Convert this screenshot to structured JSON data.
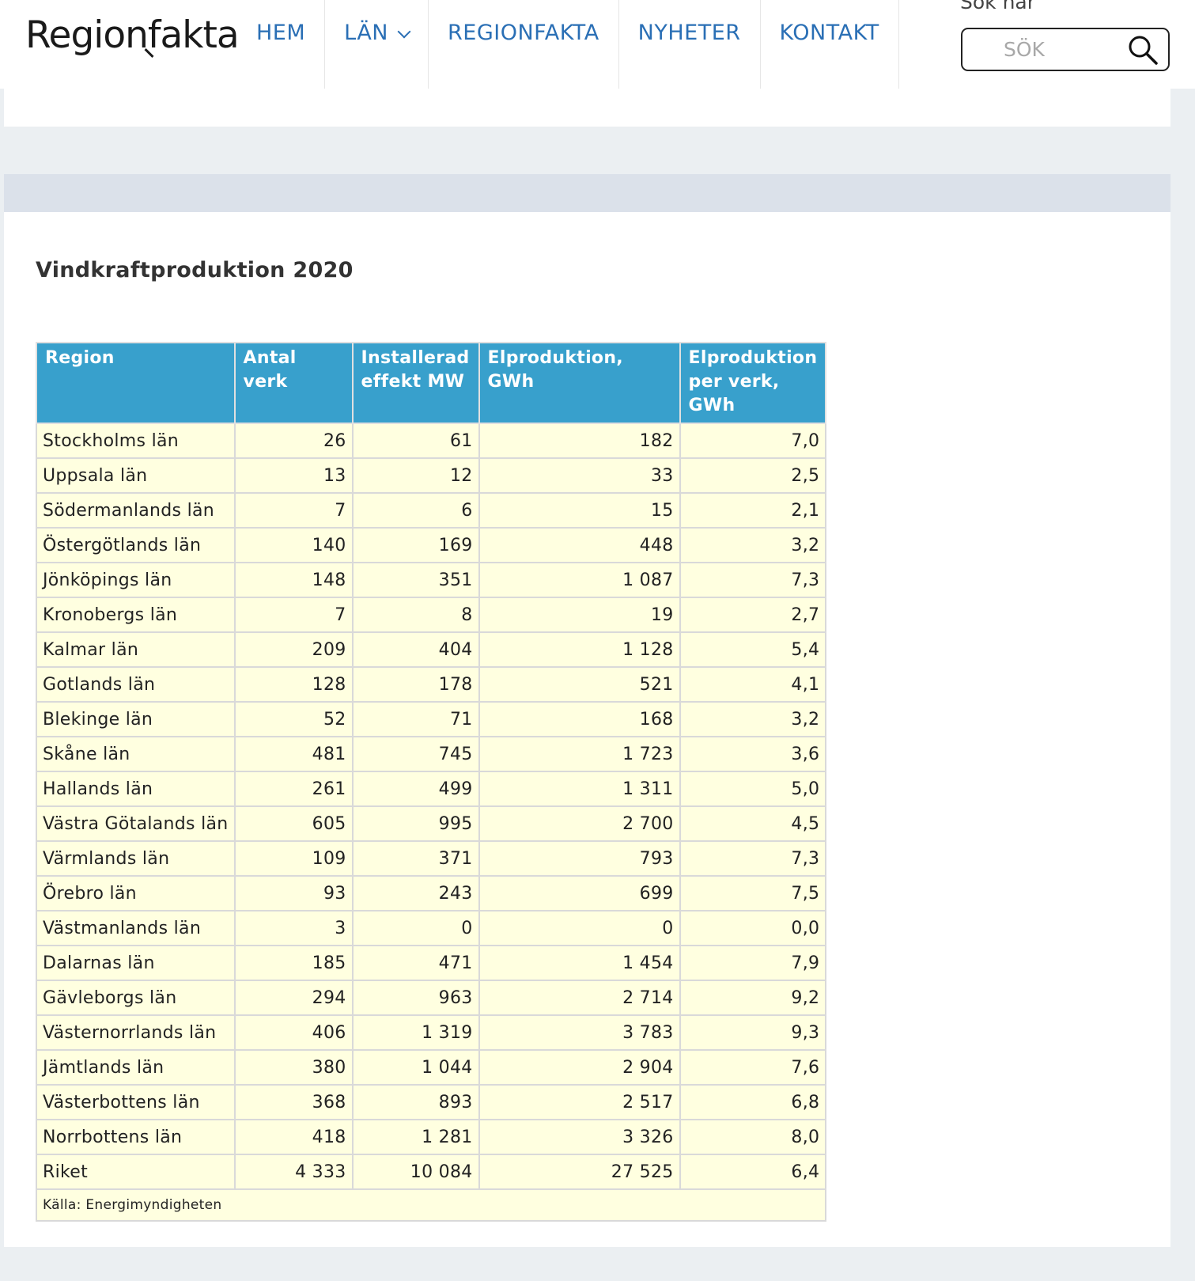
{
  "header": {
    "logo_text_before": "Regio",
    "logo_text_lens": "n",
    "logo_text_after": "fakta",
    "nav": [
      {
        "label": "HEM"
      },
      {
        "label": "LÄN"
      },
      {
        "label": "REGIONFAKTA"
      },
      {
        "label": "NYHETER"
      },
      {
        "label": "KONTAKT"
      }
    ],
    "search": {
      "label": "Sök här",
      "placeholder": "SÖK"
    }
  },
  "main": {
    "title": "Vindkraftproduktion 2020",
    "table": {
      "columns": [
        "Region",
        "Antal verk",
        "Installerad effekt MW",
        "Elproduktion, GWh",
        "Elproduktion per verk, GWh"
      ],
      "rows": [
        [
          "Stockholms län",
          "26",
          "61",
          "182",
          "7,0"
        ],
        [
          "Uppsala län",
          "13",
          "12",
          "33",
          "2,5"
        ],
        [
          "Södermanlands län",
          "7",
          "6",
          "15",
          "2,1"
        ],
        [
          "Östergötlands län",
          "140",
          "169",
          "448",
          "3,2"
        ],
        [
          "Jönköpings län",
          "148",
          "351",
          "1 087",
          "7,3"
        ],
        [
          "Kronobergs län",
          "7",
          "8",
          "19",
          "2,7"
        ],
        [
          "Kalmar län",
          "209",
          "404",
          "1 128",
          "5,4"
        ],
        [
          "Gotlands län",
          "128",
          "178",
          "521",
          "4,1"
        ],
        [
          "Blekinge län",
          "52",
          "71",
          "168",
          "3,2"
        ],
        [
          "Skåne län",
          "481",
          "745",
          "1 723",
          "3,6"
        ],
        [
          "Hallands län",
          "261",
          "499",
          "1 311",
          "5,0"
        ],
        [
          "Västra Götalands län",
          "605",
          "995",
          "2 700",
          "4,5"
        ],
        [
          "Värmlands län",
          "109",
          "371",
          "793",
          "7,3"
        ],
        [
          "Örebro län",
          "93",
          "243",
          "699",
          "7,5"
        ],
        [
          "Västmanlands län",
          "3",
          "0",
          "0",
          "0,0"
        ],
        [
          "Dalarnas län",
          "185",
          "471",
          "1 454",
          "7,9"
        ],
        [
          "Gävleborgs län",
          "294",
          "963",
          "2 714",
          "9,2"
        ],
        [
          "Västernorrlands län",
          "406",
          "1 319",
          "3 783",
          "9,3"
        ],
        [
          "Jämtlands län",
          "380",
          "1 044",
          "2 904",
          "7,6"
        ],
        [
          "Västerbottens län",
          "368",
          "893",
          "2 517",
          "6,8"
        ],
        [
          "Norrbottens län",
          "418",
          "1 281",
          "3 326",
          "8,0"
        ],
        [
          "Riket",
          "4 333",
          "10 084",
          "27 525",
          "6,4"
        ]
      ],
      "source": "Källa: Energimyndigheten"
    }
  },
  "colors": {
    "nav_link": "#2a6fb5",
    "table_header_bg": "#38a0cc",
    "table_cell_bg": "#ffffe0",
    "page_bg": "#ebeff2",
    "band_bg": "#dbe1ea"
  },
  "icons": {
    "search": "search-icon",
    "nav_dropdown": "chevron-down-icon"
  }
}
